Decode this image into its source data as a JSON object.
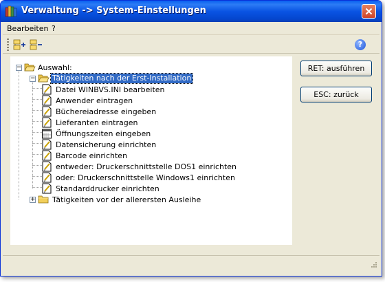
{
  "window": {
    "title": "Verwaltung -> System-Einstellungen"
  },
  "menu": {
    "items": [
      "Bearbeiten",
      "?"
    ]
  },
  "toolbar": {
    "icons": [
      "tree-expand-icon",
      "tree-collapse-icon",
      "help-icon"
    ],
    "help_label": "?"
  },
  "tree": {
    "root": "Auswahl:",
    "groups": [
      {
        "label": "Tätigkeiten nach der Erst-Installation",
        "expanded": true,
        "selected": true,
        "items": [
          "Datei WINBVS.INI bearbeiten",
          "Anwender eintragen",
          "Büchereiadresse eingeben",
          "Lieferanten eintragen",
          "Öffnungszeiten eingeben",
          "Datensicherung einrichten",
          "Barcode einrichten",
          "entweder: Druckerschnittstelle DOS1 einrichten",
          "oder: Druckerschnittstelle Windows1 einrichten",
          "Standarddrucker einrichten"
        ]
      },
      {
        "label": "Tätigkeiten vor der allerersten Ausleihe",
        "expanded": false,
        "selected": false
      }
    ]
  },
  "buttons": {
    "execute": "RET: ausführen",
    "back": "ESC: zurück"
  },
  "colors": {
    "title_bar": "#0a54e3",
    "selection": "#316ac5",
    "window_bg": "#ece9d8"
  }
}
